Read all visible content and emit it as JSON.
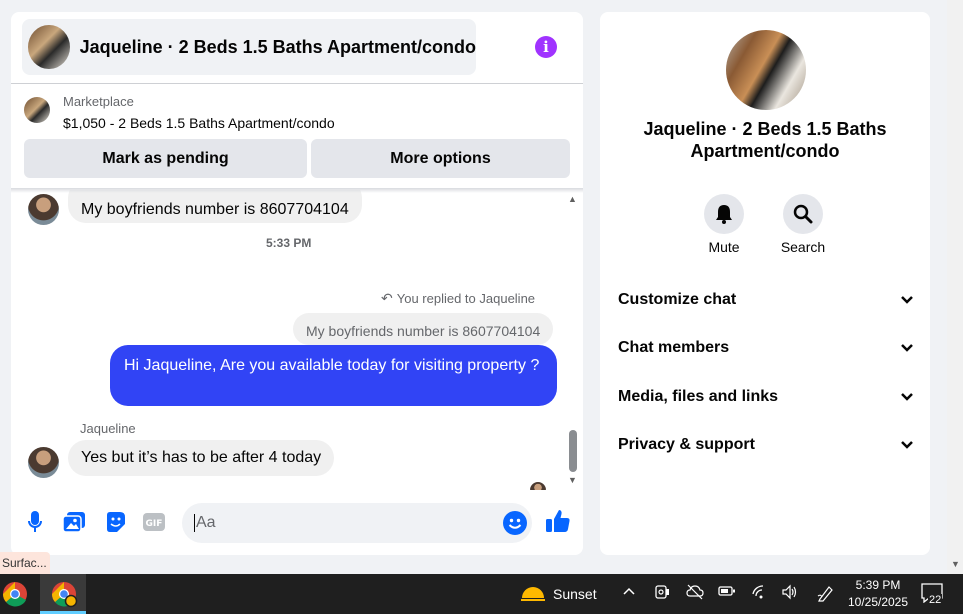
{
  "chat": {
    "title": "Jaqueline · 2 Beds 1.5 Baths Apartment/condo",
    "marketplace_label": "Marketplace",
    "listing": "$1,050 - 2 Beds 1.5 Baths Apartment/condo",
    "mark_pending_label": "Mark as pending",
    "more_options_label": "More options",
    "messages": {
      "prev_incoming": "My boyfriends number is 8607704104",
      "timestamp": "5:33 PM",
      "replied_to": "You replied to Jaqueline",
      "quoted": "My boyfriends number is 8607704104",
      "outgoing": "Hi Jaqueline, Are you available today for visiting property ?",
      "sender": "Jaqueline",
      "incoming": "Yes but it’s has to be after 4 today"
    },
    "composer": {
      "placeholder": "Aa"
    },
    "colors": {
      "accent": "#a033ff",
      "outgoing_bubble": "#3144f5",
      "icon_blue": "#0866ff"
    }
  },
  "info": {
    "title": "Jaqueline · 2 Beds 1.5 Baths Apartment/condo",
    "actions": [
      {
        "label": "Mute",
        "icon": "bell-icon"
      },
      {
        "label": "Search",
        "icon": "search-icon"
      }
    ],
    "sections": [
      {
        "label": "Customize chat"
      },
      {
        "label": "Chat members"
      },
      {
        "label": "Media, files and links"
      },
      {
        "label": "Privacy & support"
      }
    ]
  },
  "surface_tab": "Surfac...",
  "taskbar": {
    "weather": "Sunset",
    "time": "5:39 PM",
    "date": "10/25/2025",
    "notifications": "22"
  }
}
